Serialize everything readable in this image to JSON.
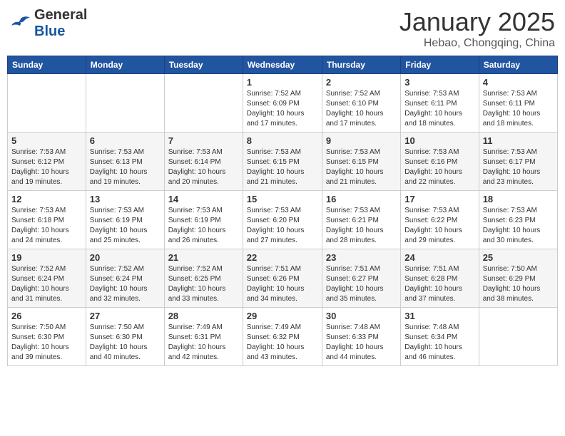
{
  "header": {
    "logo_general": "General",
    "logo_blue": "Blue",
    "month_title": "January 2025",
    "location": "Hebao, Chongqing, China"
  },
  "weekdays": [
    "Sunday",
    "Monday",
    "Tuesday",
    "Wednesday",
    "Thursday",
    "Friday",
    "Saturday"
  ],
  "weeks": [
    [
      {
        "day": "",
        "info": ""
      },
      {
        "day": "",
        "info": ""
      },
      {
        "day": "",
        "info": ""
      },
      {
        "day": "1",
        "info": "Sunrise: 7:52 AM\nSunset: 6:09 PM\nDaylight: 10 hours\nand 17 minutes."
      },
      {
        "day": "2",
        "info": "Sunrise: 7:52 AM\nSunset: 6:10 PM\nDaylight: 10 hours\nand 17 minutes."
      },
      {
        "day": "3",
        "info": "Sunrise: 7:53 AM\nSunset: 6:11 PM\nDaylight: 10 hours\nand 18 minutes."
      },
      {
        "day": "4",
        "info": "Sunrise: 7:53 AM\nSunset: 6:11 PM\nDaylight: 10 hours\nand 18 minutes."
      }
    ],
    [
      {
        "day": "5",
        "info": "Sunrise: 7:53 AM\nSunset: 6:12 PM\nDaylight: 10 hours\nand 19 minutes."
      },
      {
        "day": "6",
        "info": "Sunrise: 7:53 AM\nSunset: 6:13 PM\nDaylight: 10 hours\nand 19 minutes."
      },
      {
        "day": "7",
        "info": "Sunrise: 7:53 AM\nSunset: 6:14 PM\nDaylight: 10 hours\nand 20 minutes."
      },
      {
        "day": "8",
        "info": "Sunrise: 7:53 AM\nSunset: 6:15 PM\nDaylight: 10 hours\nand 21 minutes."
      },
      {
        "day": "9",
        "info": "Sunrise: 7:53 AM\nSunset: 6:15 PM\nDaylight: 10 hours\nand 21 minutes."
      },
      {
        "day": "10",
        "info": "Sunrise: 7:53 AM\nSunset: 6:16 PM\nDaylight: 10 hours\nand 22 minutes."
      },
      {
        "day": "11",
        "info": "Sunrise: 7:53 AM\nSunset: 6:17 PM\nDaylight: 10 hours\nand 23 minutes."
      }
    ],
    [
      {
        "day": "12",
        "info": "Sunrise: 7:53 AM\nSunset: 6:18 PM\nDaylight: 10 hours\nand 24 minutes."
      },
      {
        "day": "13",
        "info": "Sunrise: 7:53 AM\nSunset: 6:19 PM\nDaylight: 10 hours\nand 25 minutes."
      },
      {
        "day": "14",
        "info": "Sunrise: 7:53 AM\nSunset: 6:19 PM\nDaylight: 10 hours\nand 26 minutes."
      },
      {
        "day": "15",
        "info": "Sunrise: 7:53 AM\nSunset: 6:20 PM\nDaylight: 10 hours\nand 27 minutes."
      },
      {
        "day": "16",
        "info": "Sunrise: 7:53 AM\nSunset: 6:21 PM\nDaylight: 10 hours\nand 28 minutes."
      },
      {
        "day": "17",
        "info": "Sunrise: 7:53 AM\nSunset: 6:22 PM\nDaylight: 10 hours\nand 29 minutes."
      },
      {
        "day": "18",
        "info": "Sunrise: 7:53 AM\nSunset: 6:23 PM\nDaylight: 10 hours\nand 30 minutes."
      }
    ],
    [
      {
        "day": "19",
        "info": "Sunrise: 7:52 AM\nSunset: 6:24 PM\nDaylight: 10 hours\nand 31 minutes."
      },
      {
        "day": "20",
        "info": "Sunrise: 7:52 AM\nSunset: 6:24 PM\nDaylight: 10 hours\nand 32 minutes."
      },
      {
        "day": "21",
        "info": "Sunrise: 7:52 AM\nSunset: 6:25 PM\nDaylight: 10 hours\nand 33 minutes."
      },
      {
        "day": "22",
        "info": "Sunrise: 7:51 AM\nSunset: 6:26 PM\nDaylight: 10 hours\nand 34 minutes."
      },
      {
        "day": "23",
        "info": "Sunrise: 7:51 AM\nSunset: 6:27 PM\nDaylight: 10 hours\nand 35 minutes."
      },
      {
        "day": "24",
        "info": "Sunrise: 7:51 AM\nSunset: 6:28 PM\nDaylight: 10 hours\nand 37 minutes."
      },
      {
        "day": "25",
        "info": "Sunrise: 7:50 AM\nSunset: 6:29 PM\nDaylight: 10 hours\nand 38 minutes."
      }
    ],
    [
      {
        "day": "26",
        "info": "Sunrise: 7:50 AM\nSunset: 6:30 PM\nDaylight: 10 hours\nand 39 minutes."
      },
      {
        "day": "27",
        "info": "Sunrise: 7:50 AM\nSunset: 6:30 PM\nDaylight: 10 hours\nand 40 minutes."
      },
      {
        "day": "28",
        "info": "Sunrise: 7:49 AM\nSunset: 6:31 PM\nDaylight: 10 hours\nand 42 minutes."
      },
      {
        "day": "29",
        "info": "Sunrise: 7:49 AM\nSunset: 6:32 PM\nDaylight: 10 hours\nand 43 minutes."
      },
      {
        "day": "30",
        "info": "Sunrise: 7:48 AM\nSunset: 6:33 PM\nDaylight: 10 hours\nand 44 minutes."
      },
      {
        "day": "31",
        "info": "Sunrise: 7:48 AM\nSunset: 6:34 PM\nDaylight: 10 hours\nand 46 minutes."
      },
      {
        "day": "",
        "info": ""
      }
    ]
  ]
}
